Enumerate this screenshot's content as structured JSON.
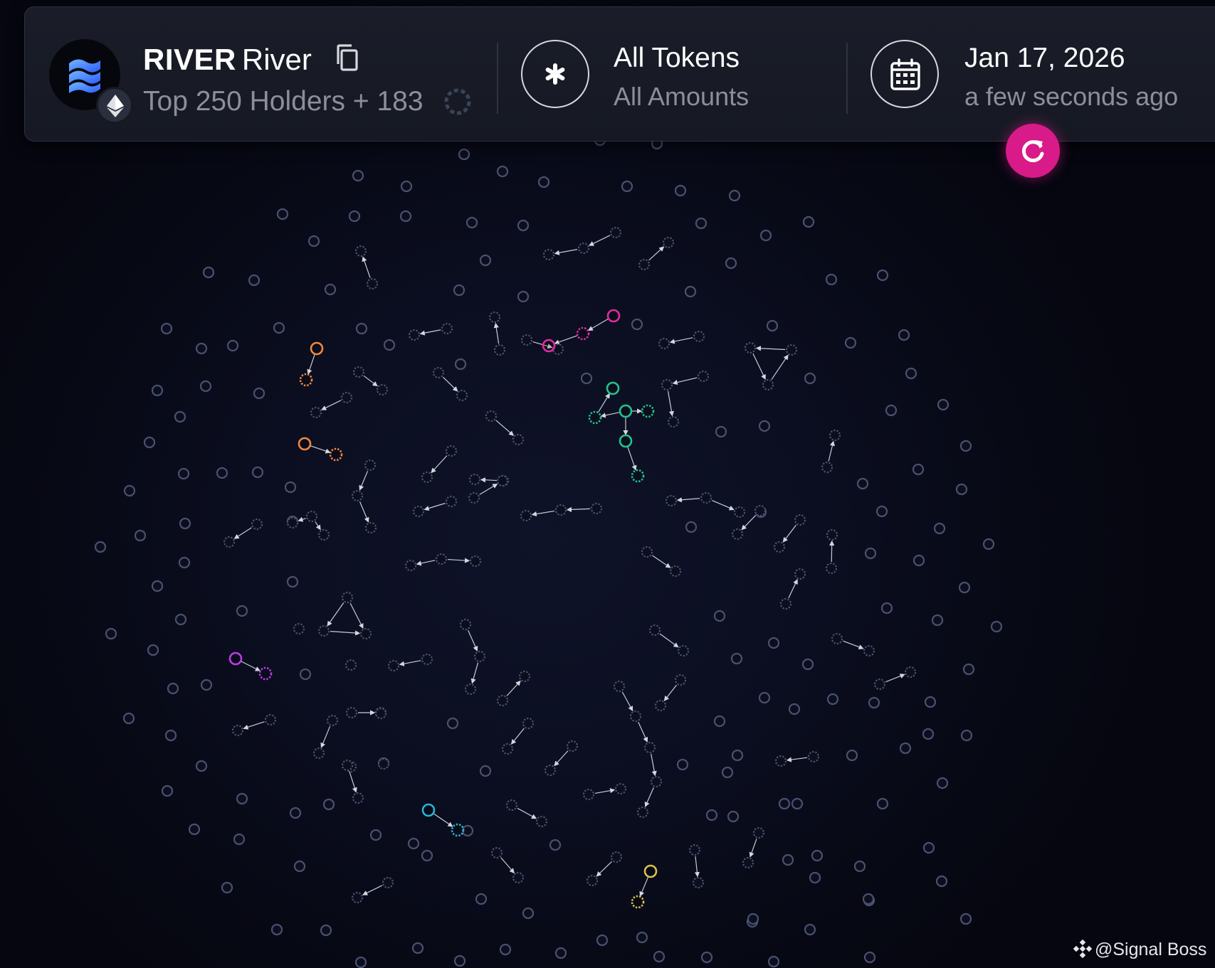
{
  "header": {
    "token_symbol": "RIVER",
    "token_name": "River",
    "holders_label": "Top 250 Holders + 183",
    "filter_main": "All Tokens",
    "filter_sub": "All Amounts",
    "date_main": "Jan 17, 2026",
    "date_sub": "a few seconds ago"
  },
  "icons": {
    "token_logo": "river-logo-icon",
    "chain_badge": "ethereum-icon",
    "copy": "copy-icon",
    "loading": "loading-ring-icon",
    "filter": "asterisk-icon",
    "date": "calendar-icon",
    "refresh": "refresh-icon",
    "watermark": "signal-boss-logo-icon"
  },
  "watermark": {
    "text": "@Signal Boss"
  },
  "colors": {
    "accent_refresh": "#d81b88",
    "node_default": "#4b5070",
    "cluster_orange": "#f0883e",
    "cluster_pink": "#e02c9e",
    "cluster_green": "#22c38a",
    "cluster_purple": "#bb3ce6",
    "cluster_cyan": "#2ab3cf",
    "cluster_yellow": "#d8c04a"
  }
}
